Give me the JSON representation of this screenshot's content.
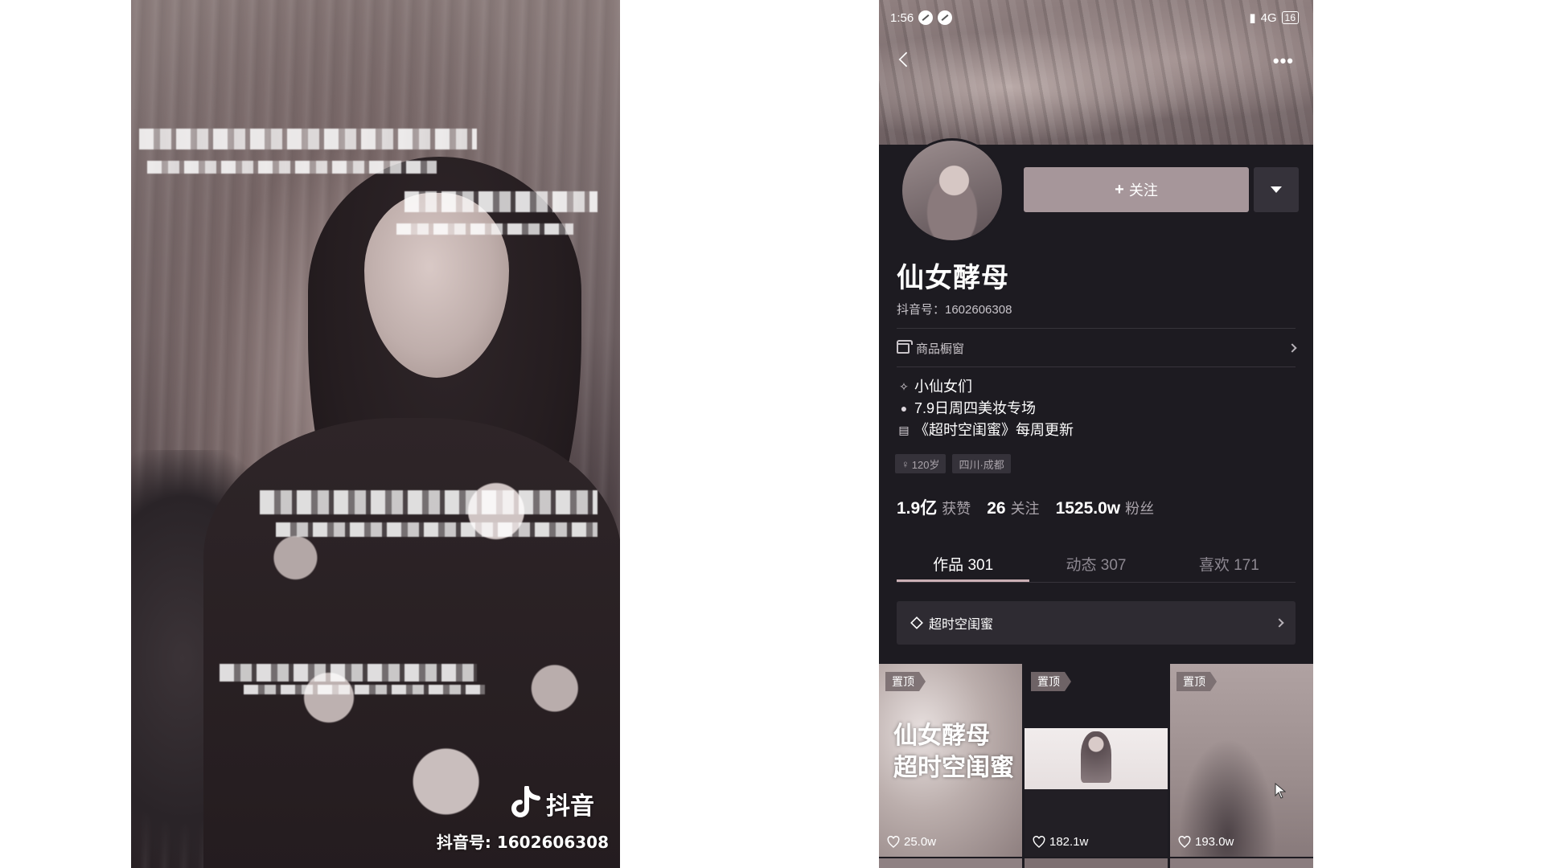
{
  "video": {
    "overlay_lines": [
      "",
      "",
      "",
      ""
    ],
    "watermark": {
      "app_name": "抖音",
      "douyin_id": "抖音号: 1602606308"
    }
  },
  "status_bar": {
    "time": "1:56",
    "network": "4G",
    "battery": "16"
  },
  "profile": {
    "follow_label": "关注",
    "name": "仙女酵母",
    "douyin_id": "抖音号：1602606308",
    "shop_label": "商品橱窗",
    "bio": [
      {
        "icon": "sparkle-icon",
        "text": "小仙女们"
      },
      {
        "icon": "balloon-icon",
        "text": "7.9日周四美妆专场"
      },
      {
        "icon": "clapper-icon",
        "text": "《超时空闺蜜》每周更新"
      }
    ],
    "tags": [
      {
        "icon": "female-icon",
        "text": "120岁"
      },
      {
        "icon": "",
        "text": "四川·成都"
      }
    ],
    "stats": [
      {
        "value": "1.9亿",
        "label": "获赞"
      },
      {
        "value": "26",
        "label": "关注"
      },
      {
        "value": "1525.0w",
        "label": "粉丝"
      }
    ],
    "tabs": [
      {
        "label": "作品 301",
        "active": true
      },
      {
        "label": "动态 307",
        "active": false
      },
      {
        "label": "喜欢 171",
        "active": false
      }
    ],
    "collection_label": "超时空闺蜜",
    "videos": [
      {
        "pinned": "置顶",
        "title_line1": "仙女酵母",
        "title_line2": "超时空闺蜜",
        "likes": "25.0w"
      },
      {
        "pinned": "置顶",
        "likes": "182.1w"
      },
      {
        "pinned": "置顶",
        "likes": "193.0w"
      }
    ]
  },
  "colors": {
    "profile_bg": "#1d1b21",
    "follow_button": "#a6969a",
    "tab_indicator": "#cbb0b5"
  }
}
